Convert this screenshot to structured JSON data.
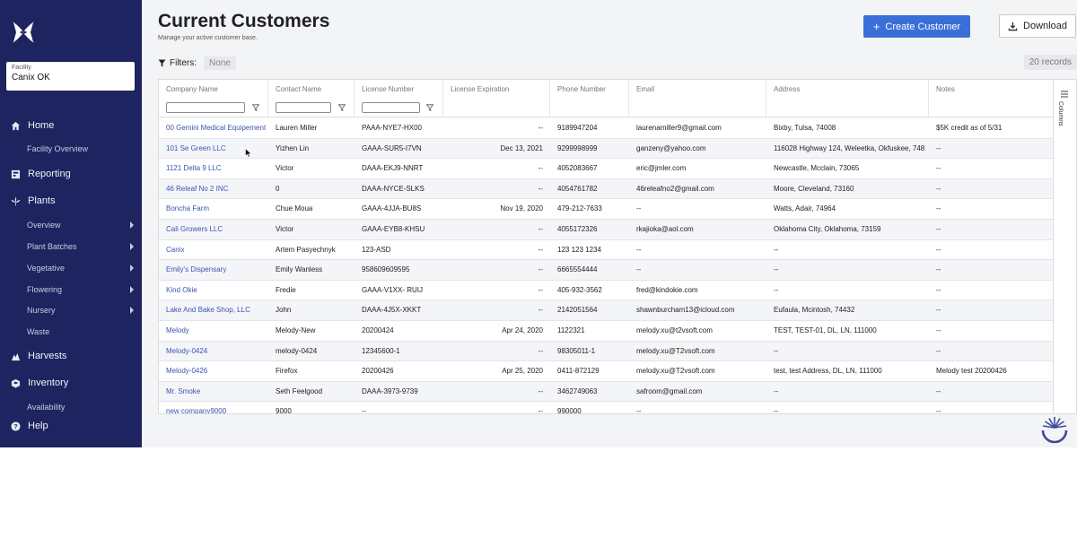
{
  "sidebar": {
    "facility_label": "Facility",
    "facility_value": "Canix OK",
    "items": [
      {
        "label": "Home",
        "icon": "home-icon",
        "type": "top"
      },
      {
        "label": "Facility Overview",
        "type": "sub"
      },
      {
        "label": "Reporting",
        "icon": "reporting-icon",
        "type": "top"
      },
      {
        "label": "Plants",
        "icon": "plant-icon",
        "type": "top"
      },
      {
        "label": "Overview",
        "type": "sub",
        "chevron": true
      },
      {
        "label": "Plant Batches",
        "type": "sub",
        "chevron": true
      },
      {
        "label": "Vegetative",
        "type": "sub",
        "chevron": true
      },
      {
        "label": "Flowering",
        "type": "sub",
        "chevron": true
      },
      {
        "label": "Nursery",
        "type": "sub",
        "chevron": true
      },
      {
        "label": "Waste",
        "type": "sub"
      },
      {
        "label": "Harvests",
        "icon": "harvest-icon",
        "type": "top"
      },
      {
        "label": "Inventory",
        "icon": "inventory-icon",
        "type": "top"
      },
      {
        "label": "Availability",
        "type": "sub"
      },
      {
        "label": "Help",
        "icon": "help-icon",
        "type": "top"
      }
    ]
  },
  "header": {
    "title": "Current Customers",
    "subtitle": "Manage your active customer base.",
    "create_label": "Create Customer",
    "download_label": "Download"
  },
  "filters": {
    "label": "Filters:",
    "value": "None",
    "records": "20 records"
  },
  "columns_label": "Columns",
  "table": {
    "columns": [
      "Company Name",
      "Contact Name",
      "License Number",
      "License Expiration",
      "Phone Number",
      "Email",
      "Address",
      "Notes"
    ],
    "rows": [
      [
        "00 Gemini Medical Equipement",
        "Lauren Miller",
        "PAAA-NYE7-HX00",
        "--",
        "9189947204",
        "laurenamiller9@gmail.com",
        "Bixby, Tulsa, 74008",
        "$5K credit as of 5/31"
      ],
      [
        "101 Se Green LLC",
        "Yizhen Lin",
        "GAAA-SUR5-I7VN",
        "Dec 13, 2021",
        "9299998999",
        "ganzeny@yahoo.com",
        "116028 Highway 124, Weleetka, Okfuskee, 748",
        "--"
      ],
      [
        "1121 Delta 9 LLC",
        "Victor",
        "DAAA-EKJ9-NNRT",
        "--",
        "4052083667",
        "eric@jmler.com",
        "Newcastle, Mcclain, 73065",
        "--"
      ],
      [
        "46 Releaf No 2 INC",
        "0",
        "DAAA-NYCE-SLKS",
        "--",
        "4054761782",
        "46releafno2@gmail.com",
        "Moore, Cleveland, 73160",
        "--"
      ],
      [
        "Boncha Farm",
        "Chue Moua",
        "GAAA-4JJA-BU8S",
        "Nov 19, 2020",
        "479-212-7633",
        "--",
        "Watts, Adair, 74964",
        "--"
      ],
      [
        "Cali Growers LLC",
        "Victor",
        "GAAA-EYB8-KHSU",
        "--",
        "4055172326",
        "rkajioka@aol.com",
        "Oklahoma City, Oklahoma, 73159",
        "--"
      ],
      [
        "Canix",
        "Artem Pasyechnyk",
        "123-ASD",
        "--",
        "123 123 1234",
        "--",
        "--",
        "--"
      ],
      [
        "Emily's Dispensary",
        "Emily Wanless",
        "958609609595",
        "--",
        "6665554444",
        "--",
        "--",
        "--"
      ],
      [
        "Kind Okie",
        "Fredie",
        "GAAA-V1XX- RUIJ",
        "--",
        "405-932-3562",
        "fred@kindokie.com",
        "--",
        "--"
      ],
      [
        "Lake And Bake Shop, LLC",
        "John",
        "DAAA-4J5X-XKKT",
        "--",
        "2142051564",
        "shawnburcham13@icloud.com",
        "Eufaula, Mcintosh, 74432",
        "--"
      ],
      [
        "Melody",
        "Melody-New",
        "20200424",
        "Apr 24, 2020",
        "1122321",
        "melody.xu@t2vsoft.com",
        "TEST, TEST-01, DL, LN, 111000",
        "--"
      ],
      [
        "Melody-0424",
        "melody-0424",
        "12345600-1",
        "--",
        "98305011-1",
        "melody.xu@T2vsoft.com",
        "--",
        "--"
      ],
      [
        "Melody-0426",
        "Firefox",
        "20200426",
        "Apr 25, 2020",
        "0411-872129",
        "melody.xu@T2vsoft.com",
        "test, test Address, DL, LN, 111000",
        "Melody test 20200426"
      ],
      [
        "Mr. Smoke",
        "Seth Feelgood",
        "DAAA-3973-9739",
        "--",
        "3462749063",
        "safroom@gmail.com",
        "--",
        "--"
      ],
      [
        "new company9000",
        "9000",
        "--",
        "--",
        "990000",
        "--",
        "--",
        "--"
      ]
    ]
  },
  "colors": {
    "sidebar_bg": "#1d2460",
    "primary": "#3b6fd8",
    "link": "#3b55b0"
  }
}
